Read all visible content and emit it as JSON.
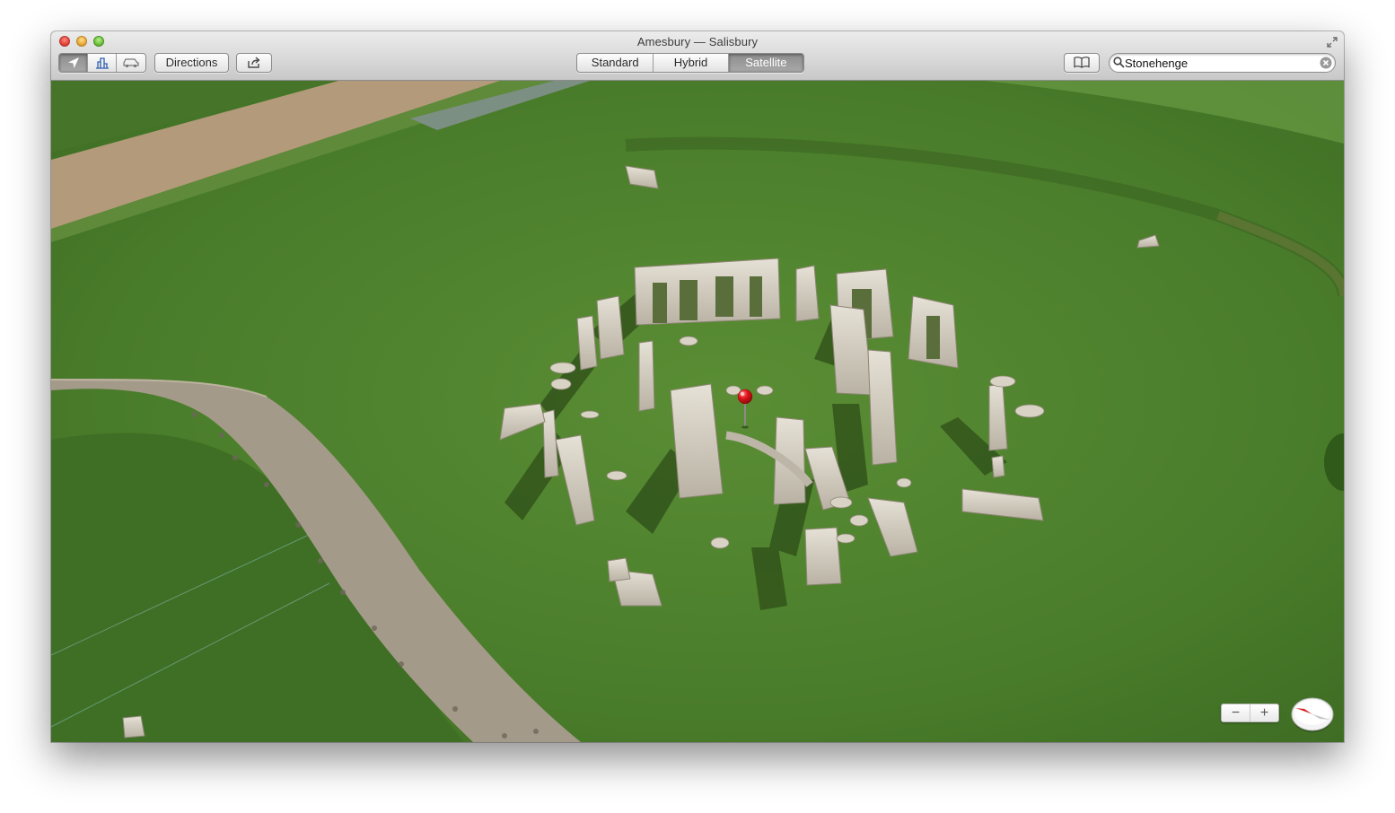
{
  "window": {
    "title": "Amesbury — Salisbury"
  },
  "toolbar": {
    "location_icon": "location-arrow-icon",
    "view_3d_icon": "3d-buildings-icon",
    "traffic_icon": "car-icon",
    "directions_label": "Directions",
    "share_icon": "share-icon",
    "map_modes": [
      {
        "label": "Standard",
        "active": false
      },
      {
        "label": "Hybrid",
        "active": false
      },
      {
        "label": "Satellite",
        "active": true
      }
    ],
    "bookmarks_icon": "bookmarks-book-icon"
  },
  "search": {
    "value": "Stonehenge",
    "icon": "magnifier-icon",
    "clear_icon": "clear-icon"
  },
  "map": {
    "pin_color": "#e3161b",
    "grass_color": "#4e7f2c",
    "path_color": "#a69b88",
    "stone_color": "#cfc9bd"
  },
  "controls": {
    "zoom_out": "−",
    "zoom_in": "+",
    "compass_icon": "compass-icon"
  }
}
